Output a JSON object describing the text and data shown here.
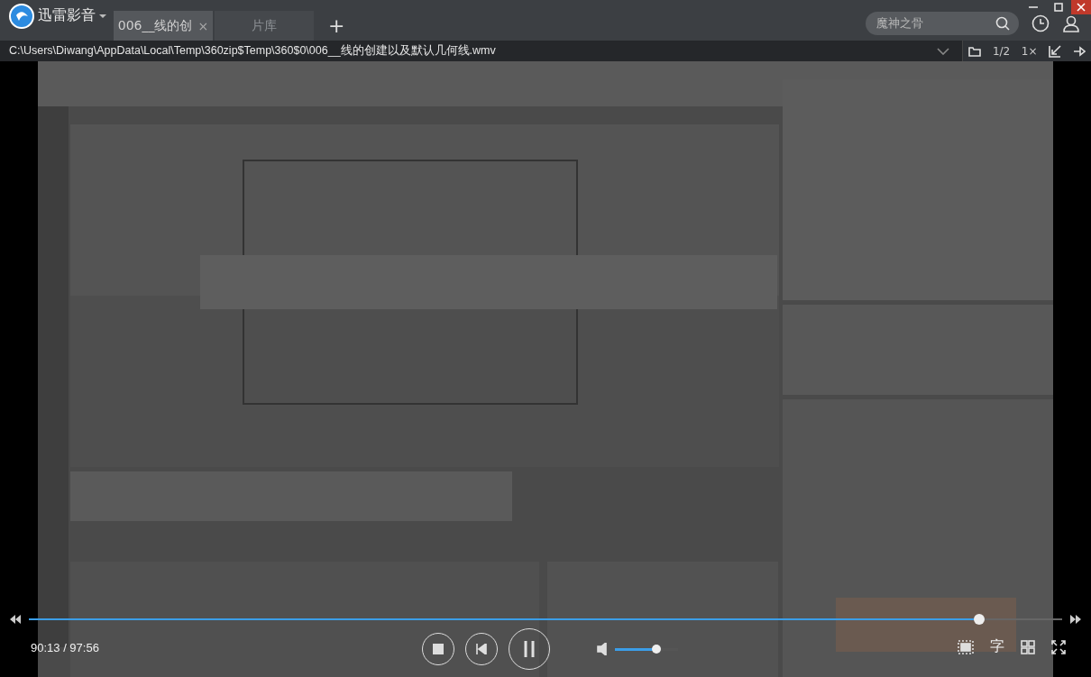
{
  "app": {
    "name": "迅雷影音"
  },
  "tabs": [
    {
      "label": "006__线的创",
      "selected": true,
      "close": "×"
    },
    {
      "label": "片库",
      "selected": false
    }
  ],
  "new_tab": "+",
  "search": {
    "value": "魔神之骨"
  },
  "file_path": "C:\\Users\\Diwang\\AppData\\Local\\Temp\\360zip$Temp\\360$0\\006__线的创建以及默认几何线.wmv",
  "toolbar": {
    "half_size": "1/2",
    "speed": "1×"
  },
  "player": {
    "progress": {
      "level": 0.92
    },
    "time": "90:13 / 97:56",
    "volume": {
      "level": 0.65
    },
    "subtitle": "字"
  }
}
